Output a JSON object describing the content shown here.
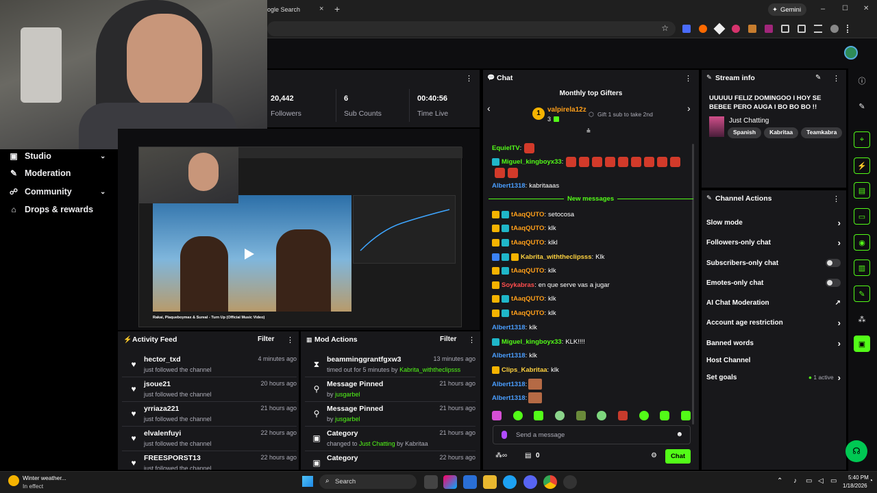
{
  "browser": {
    "tab_title": "ogle Search",
    "tab_close": "×",
    "new_tab": "+",
    "gemini_label": "Gemini",
    "minimize": "–",
    "maximize": "☐",
    "close": "✕"
  },
  "stats": [
    {
      "value": "20,442",
      "label": "Followers"
    },
    {
      "value": "6",
      "label": "Sub Counts"
    },
    {
      "value": "00:40:56",
      "label": "Time Live"
    }
  ],
  "sidebar": {
    "items": [
      {
        "label": "Studio",
        "icon": "studio-icon",
        "chevron": true
      },
      {
        "label": "Moderation",
        "icon": "wrench-icon",
        "chevron": false
      },
      {
        "label": "Community",
        "icon": "people-icon",
        "chevron": true
      },
      {
        "label": "Drops & rewards",
        "icon": "gift-icon",
        "chevron": false
      }
    ]
  },
  "video": {
    "title_bar": "Rakai, Plaqueboymax & Sureal - Turn Up (Official Music Video)"
  },
  "activity_feed": {
    "title": "Activity Feed",
    "filter": "Filter",
    "rows": [
      {
        "name": "hector_txd",
        "sub": "just followed the channel",
        "time": "4 minutes ago"
      },
      {
        "name": "jsoue21",
        "sub": "just followed the channel",
        "time": "20 hours ago"
      },
      {
        "name": "yrriaza221",
        "sub": "just followed the channel",
        "time": "21 hours ago"
      },
      {
        "name": "elvalenfuyi",
        "sub": "just followed the channel",
        "time": "22 hours ago"
      },
      {
        "name": "FREESPORST13",
        "sub": "just followed the channel",
        "time": "22 hours ago"
      }
    ]
  },
  "mod_actions": {
    "title": "Mod Actions",
    "filter": "Filter",
    "rows": [
      {
        "title": "beamminggrantfgxw3",
        "prefix": "timed out for 5 minutes by ",
        "user": "Kabrita_withtheclipsss",
        "suffix": "",
        "time": "13 minutes ago",
        "icon": "hourglass-icon"
      },
      {
        "title": "Message Pinned",
        "prefix": "by ",
        "user": "jusgarbel",
        "suffix": "",
        "time": "21 hours ago",
        "icon": "pin-icon"
      },
      {
        "title": "Message Pinned",
        "prefix": "by ",
        "user": "jusgarbel",
        "suffix": "",
        "time": "21 hours ago",
        "icon": "pin-icon"
      },
      {
        "title": "Category",
        "prefix": "changed to ",
        "user": "Just Chatting",
        "suffix": " by Kabritaa",
        "time": "21 hours ago",
        "icon": "category-icon"
      },
      {
        "title": "Category",
        "prefix": "",
        "user": "",
        "suffix": "",
        "time": "22 hours ago",
        "icon": "category-icon"
      }
    ]
  },
  "chat": {
    "title": "Chat",
    "gifters_title": "Monthly top Gifters",
    "top_gifter": "valpirela12z",
    "top_gifter_count": "3",
    "gift_hint": "Gift 1 sub to take 2nd",
    "new_messages": "New messages",
    "placeholder": "Send a message",
    "points": "0",
    "send": "Chat",
    "messages": [
      {
        "user": "EquielTV",
        "text": "",
        "color": "#53fc18",
        "badges": [],
        "emotes": 1,
        "faces": 0
      },
      {
        "user": "Miguel_kingboyx33",
        "text": "",
        "color": "#53fc18",
        "badges": [
          "mod"
        ],
        "emotes": 9,
        "faces": 0
      },
      {
        "user": "",
        "text": "",
        "color": "#53fc18",
        "badges": [],
        "emotes": 2,
        "faces": 0
      },
      {
        "user": "Albert1318",
        "text": "kabritaaas",
        "color": "#4a9eff",
        "badges": [],
        "emotes": 0,
        "faces": 0
      },
      {
        "user": "tAaqQUTO",
        "text": "setocosa",
        "color": "#ff9f1a",
        "badges": [
          "crown",
          "mod"
        ],
        "emotes": 0,
        "faces": 0
      },
      {
        "user": "tAaqQUTO",
        "text": "klk",
        "color": "#ff9f1a",
        "badges": [
          "crown",
          "mod"
        ],
        "emotes": 0,
        "faces": 0
      },
      {
        "user": "tAaqQUTO",
        "text": "klkl",
        "color": "#ff9f1a",
        "badges": [
          "crown",
          "mod"
        ],
        "emotes": 0,
        "faces": 0
      },
      {
        "user": "Kabrita_withtheclipsss",
        "text": "Klk",
        "color": "#ffd23f",
        "badges": [
          "vip",
          "mod",
          "crown"
        ],
        "emotes": 0,
        "faces": 0
      },
      {
        "user": "tAaqQUTO",
        "text": "klk",
        "color": "#ff9f1a",
        "badges": [
          "crown",
          "mod"
        ],
        "emotes": 0,
        "faces": 0
      },
      {
        "user": "Soykabras",
        "text": "en que serve vas a jugar",
        "color": "#ff4d4d",
        "badges": [
          "crown"
        ],
        "emotes": 0,
        "faces": 0
      },
      {
        "user": "tAaqQUTO",
        "text": "klk",
        "color": "#ff9f1a",
        "badges": [
          "crown",
          "mod"
        ],
        "emotes": 0,
        "faces": 0
      },
      {
        "user": "tAaqQUTO",
        "text": "klk",
        "color": "#ff9f1a",
        "badges": [
          "crown",
          "mod"
        ],
        "emotes": 0,
        "faces": 0
      },
      {
        "user": "Albert1318",
        "text": "klk",
        "color": "#4a9eff",
        "badges": [],
        "emotes": 0,
        "faces": 0
      },
      {
        "user": "Miguel_kingboyx33",
        "text": "KLK!!!!",
        "color": "#53fc18",
        "badges": [
          "mod"
        ],
        "emotes": 0,
        "faces": 0
      },
      {
        "user": "Albert1318",
        "text": "klk",
        "color": "#4a9eff",
        "badges": [],
        "emotes": 0,
        "faces": 0
      },
      {
        "user": "Clips_Kabritaa",
        "text": "klk",
        "color": "#ffd23f",
        "badges": [
          "crown"
        ],
        "emotes": 0,
        "faces": 0
      },
      {
        "user": "Albert1318",
        "text": "",
        "color": "#4a9eff",
        "badges": [],
        "emotes": 0,
        "faces": 1
      },
      {
        "user": "Albert1318",
        "text": "",
        "color": "#4a9eff",
        "badges": [],
        "emotes": 0,
        "faces": 1
      }
    ]
  },
  "stream_info": {
    "title": "Stream info",
    "stream_title": "UUUUU FELIZ DOMINGOO I HOY SE BEBEE PERO AUGA I BO BO BO !!",
    "category": "Just Chatting",
    "tags": [
      "Spanish",
      "Kabritaa",
      "Teamkabra"
    ]
  },
  "channel_actions": {
    "title": "Channel Actions",
    "items": [
      {
        "label": "Slow mode",
        "control": "chevron"
      },
      {
        "label": "Followers-only chat",
        "control": "chevron"
      },
      {
        "label": "Subscribers-only chat",
        "control": "toggle"
      },
      {
        "label": "Emotes-only chat",
        "control": "toggle"
      },
      {
        "label": "AI Chat Moderation",
        "control": "external"
      },
      {
        "label": "Account age restriction",
        "control": "chevron"
      },
      {
        "label": "Banned words",
        "control": "chevron"
      },
      {
        "label": "Host Channel",
        "control": "none"
      },
      {
        "label": "Set goals",
        "control": "chevron",
        "status": "1 active"
      }
    ]
  },
  "taskbar": {
    "weather_title": "Winter weather...",
    "weather_sub": "In effect",
    "search": "Search",
    "time": "5:40 PM",
    "date": "1/18/2026"
  },
  "colors": {
    "accent": "#53fc18",
    "panel": "#18181b",
    "bg": "#000000"
  }
}
